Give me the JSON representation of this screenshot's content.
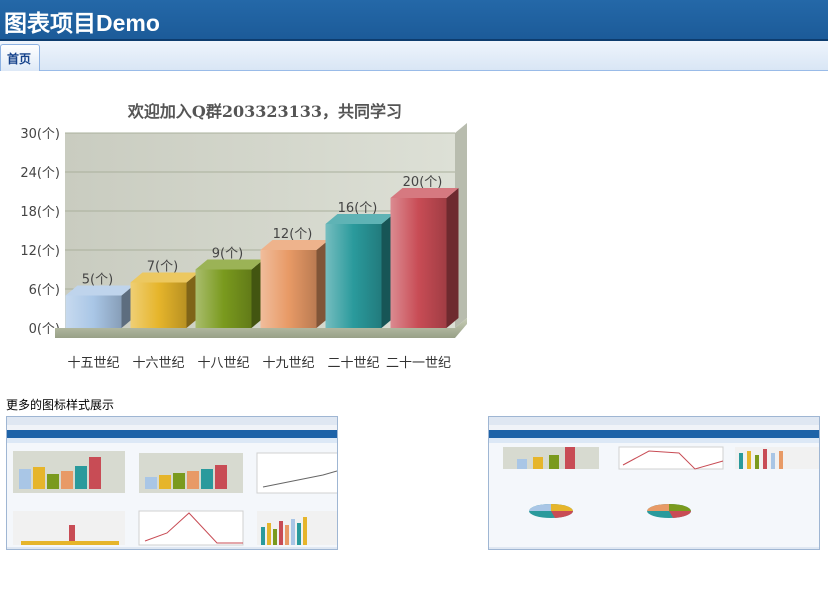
{
  "app": {
    "title": "图表项目Demo"
  },
  "tabs": [
    {
      "label": "首页"
    }
  ],
  "chart_data": {
    "type": "bar",
    "title": "欢迎加入Q群203323133，共同学习",
    "categories": [
      "十五世纪",
      "十六世纪",
      "十八世纪",
      "十九世纪",
      "二十世纪",
      "二十一世纪"
    ],
    "values": [
      5,
      7,
      9,
      12,
      16,
      20
    ],
    "data_labels": [
      "5(个)",
      "7(个)",
      "9(个)",
      "12(个)",
      "16(个)",
      "20(个)"
    ],
    "y_ticks": [
      "0(个)",
      "6(个)",
      "12(个)",
      "18(个)",
      "24(个)",
      "30(个)"
    ],
    "ylim": [
      0,
      30
    ],
    "grid": true,
    "legend": "none",
    "colors": [
      "#a9c6e6",
      "#e6b52b",
      "#7a9a1e",
      "#e89a66",
      "#2a9a9c",
      "#c84c55"
    ]
  },
  "more": {
    "label": "更多的图标样式展示"
  },
  "previews": [
    {
      "name": "preview-dashboard-1"
    },
    {
      "name": "preview-dashboard-2"
    }
  ]
}
